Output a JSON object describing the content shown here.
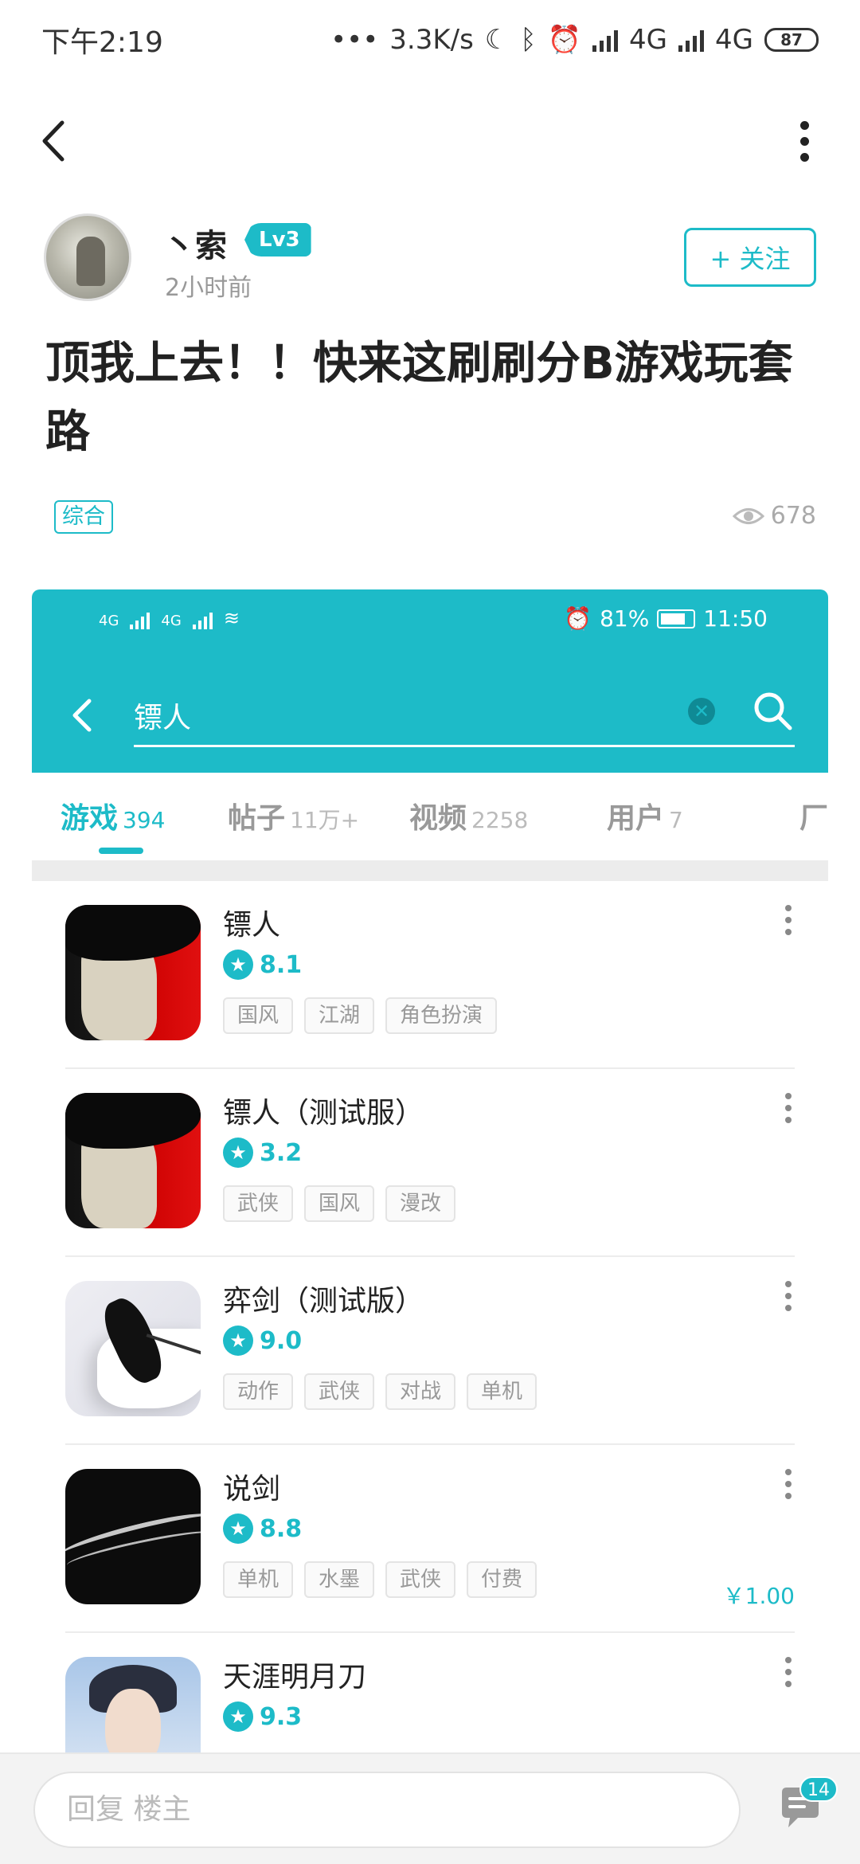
{
  "status_bar": {
    "time": "下午2:19",
    "net_speed": "3.3K/s",
    "net1": "4G",
    "net2": "4G",
    "battery": "87"
  },
  "post": {
    "author": "丶索",
    "level": "Lv3",
    "time_ago": "2小时前",
    "follow_label": "+ 关注",
    "title": "顶我上去！！快来这刷刷分B游戏玩套路",
    "category": "综合",
    "views": "678"
  },
  "screenshot": {
    "status": {
      "battery": "81%",
      "time": "11:50"
    },
    "search_query": "镖人",
    "tabs": [
      {
        "label": "游戏",
        "count": "394"
      },
      {
        "label": "帖子",
        "count": "11万+"
      },
      {
        "label": "视频",
        "count": "2258"
      },
      {
        "label": "用户",
        "count": "7"
      },
      {
        "label": "厂",
        "count": ""
      }
    ],
    "games": [
      {
        "name": "镖人",
        "rating": "8.1",
        "tags": [
          "国风",
          "江湖",
          "角色扮演"
        ],
        "price": "",
        "icon": "biaoren-icon"
      },
      {
        "name": "镖人（测试服）",
        "rating": "3.2",
        "tags": [
          "武侠",
          "国风",
          "漫改"
        ],
        "price": "",
        "icon": "biaoren-icon"
      },
      {
        "name": "弈剑（测试版）",
        "rating": "9.0",
        "tags": [
          "动作",
          "武侠",
          "对战",
          "单机"
        ],
        "price": "",
        "icon": "yijian-icon"
      },
      {
        "name": "说剑",
        "rating": "8.8",
        "tags": [
          "单机",
          "水墨",
          "武侠",
          "付费"
        ],
        "price": "￥1.00",
        "icon": "shuojian-icon"
      },
      {
        "name": "天涯明月刀",
        "rating": "9.3",
        "tags": [],
        "price": "",
        "icon": "tianya-icon"
      }
    ]
  },
  "reply": {
    "placeholder": "回复  楼主",
    "comment_count": "14"
  },
  "colors": {
    "accent": "#1dbbc8"
  }
}
